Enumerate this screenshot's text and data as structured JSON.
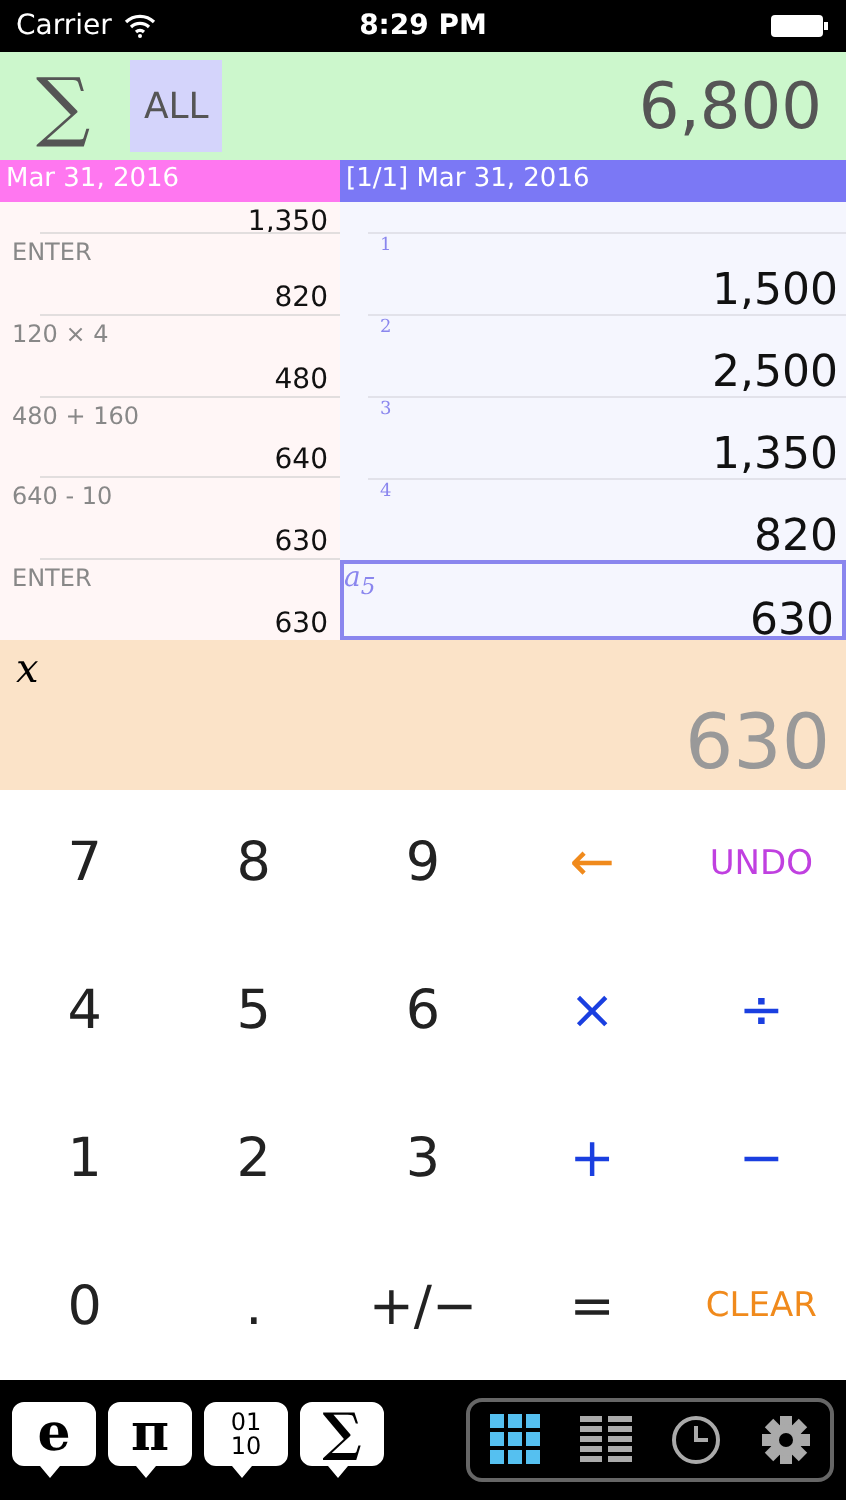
{
  "status_bar": {
    "carrier": "Carrier",
    "time": "8:29 PM"
  },
  "summary": {
    "sigma": "∑",
    "filter": "ALL",
    "filter_selected": true,
    "total": "6,800"
  },
  "history": {
    "date": "Mar 31, 2016",
    "rows": [
      {
        "expression": "",
        "result": "1,350"
      },
      {
        "expression": "ENTER",
        "result": "820"
      },
      {
        "expression": "120 × 4",
        "result": "480"
      },
      {
        "expression": "480 + 160",
        "result": "640"
      },
      {
        "expression": "640 - 10",
        "result": "630"
      },
      {
        "expression": "ENTER",
        "result": "630"
      }
    ]
  },
  "stack": {
    "header": "[1/1] Mar 31, 2016",
    "rows": [
      {
        "index": "1",
        "value": "1,500",
        "selected": false
      },
      {
        "index": "2",
        "value": "2,500",
        "selected": false
      },
      {
        "index": "3",
        "value": "1,350",
        "selected": false
      },
      {
        "index": "4",
        "value": "820",
        "selected": false
      },
      {
        "index": "a$_{5}$",
        "value": "630",
        "selected": true
      }
    ]
  },
  "input": {
    "variable": "x",
    "value": "630"
  },
  "keypad": [
    {
      "label": "7",
      "color": "#222222"
    },
    {
      "label": "8",
      "color": "#222222"
    },
    {
      "label": "9",
      "color": "#222222"
    },
    {
      "label": "←",
      "color": "#f08a1c"
    },
    {
      "label": "UNDO",
      "color": "#c040e0"
    },
    {
      "label": "4",
      "color": "#222222"
    },
    {
      "label": "5",
      "color": "#222222"
    },
    {
      "label": "6",
      "color": "#222222"
    },
    {
      "label": "×",
      "color": "#1a3fe0"
    },
    {
      "label": "÷",
      "color": "#1a3fe0"
    },
    {
      "label": "1",
      "color": "#222222"
    },
    {
      "label": "2",
      "color": "#222222"
    },
    {
      "label": "3",
      "color": "#222222"
    },
    {
      "label": "+",
      "color": "#1a3fe0"
    },
    {
      "label": "−",
      "color": "#1a3fe0"
    },
    {
      "label": "0",
      "color": "#222222"
    },
    {
      "label": ".",
      "color": "#222222"
    },
    {
      "label": "+/−",
      "color": "#222222"
    },
    {
      "label": "=",
      "color": "#222222"
    },
    {
      "label": "CLEAR",
      "color": "#f08a1c"
    }
  ],
  "functions": [
    {
      "kind": "text",
      "label": "e"
    },
    {
      "kind": "text",
      "label": "π"
    },
    {
      "kind": "binary",
      "lines": [
        "01",
        "10"
      ]
    },
    {
      "kind": "text",
      "label": "∑"
    }
  ],
  "views": [
    {
      "kind": "keypad",
      "selected": true
    },
    {
      "kind": "list",
      "selected": false
    },
    {
      "kind": "history",
      "selected": false
    },
    {
      "kind": "settings",
      "selected": false
    }
  ]
}
